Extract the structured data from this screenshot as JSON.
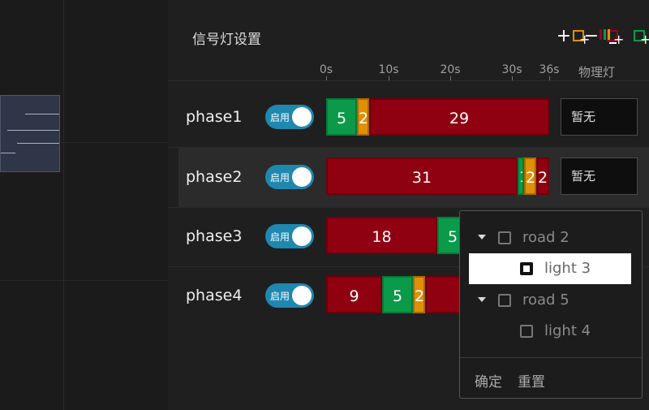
{
  "panel": {
    "title": "信号灯设置"
  },
  "toolbar": {
    "add_label": "+",
    "remove_label": "−",
    "add_red_label": "+",
    "add_green_label": "+",
    "add_yellow_label": "+",
    "colors": {
      "red": "#a0001a",
      "green": "#0b9a4a",
      "yellow": "#e08f06"
    }
  },
  "timeline": {
    "ticks": [
      "0s",
      "10s",
      "20s",
      "30s",
      "36s"
    ],
    "physical_light_header": "物理灯"
  },
  "phases": [
    {
      "name": "phase1",
      "toggle_label": "启用",
      "enabled": true,
      "selected": false,
      "segments": [
        {
          "color": "green",
          "value": "5"
        },
        {
          "color": "yellow",
          "value": "2"
        },
        {
          "color": "red",
          "value": "29"
        }
      ],
      "physical_light": "暂无"
    },
    {
      "name": "phase2",
      "toggle_label": "启用",
      "enabled": true,
      "selected": true,
      "segments": [
        {
          "color": "red",
          "value": "31"
        },
        {
          "color": "green",
          "value": "1"
        },
        {
          "color": "yellow",
          "value": "2"
        },
        {
          "color": "red",
          "value": "2"
        }
      ],
      "physical_light": "暂无"
    },
    {
      "name": "phase3",
      "toggle_label": "启用",
      "enabled": true,
      "selected": false,
      "segments": [
        {
          "color": "red",
          "value": "18"
        },
        {
          "color": "green",
          "value": "5"
        }
      ],
      "physical_light": ""
    },
    {
      "name": "phase4",
      "toggle_label": "启用",
      "enabled": true,
      "selected": false,
      "segments": [
        {
          "color": "red",
          "value": "9"
        },
        {
          "color": "green",
          "value": "5"
        },
        {
          "color": "yellow",
          "value": "2"
        },
        {
          "color": "red",
          "value": ""
        }
      ],
      "physical_light": ""
    }
  ],
  "popup": {
    "tree": [
      {
        "label": "road 2",
        "type": "group",
        "checked": false
      },
      {
        "label": "light 3",
        "type": "item",
        "checked": true,
        "highlighted": true
      },
      {
        "label": "road 5",
        "type": "group",
        "checked": false
      },
      {
        "label": "light 4",
        "type": "item",
        "checked": false
      }
    ],
    "confirm_label": "确定",
    "reset_label": "重置"
  }
}
